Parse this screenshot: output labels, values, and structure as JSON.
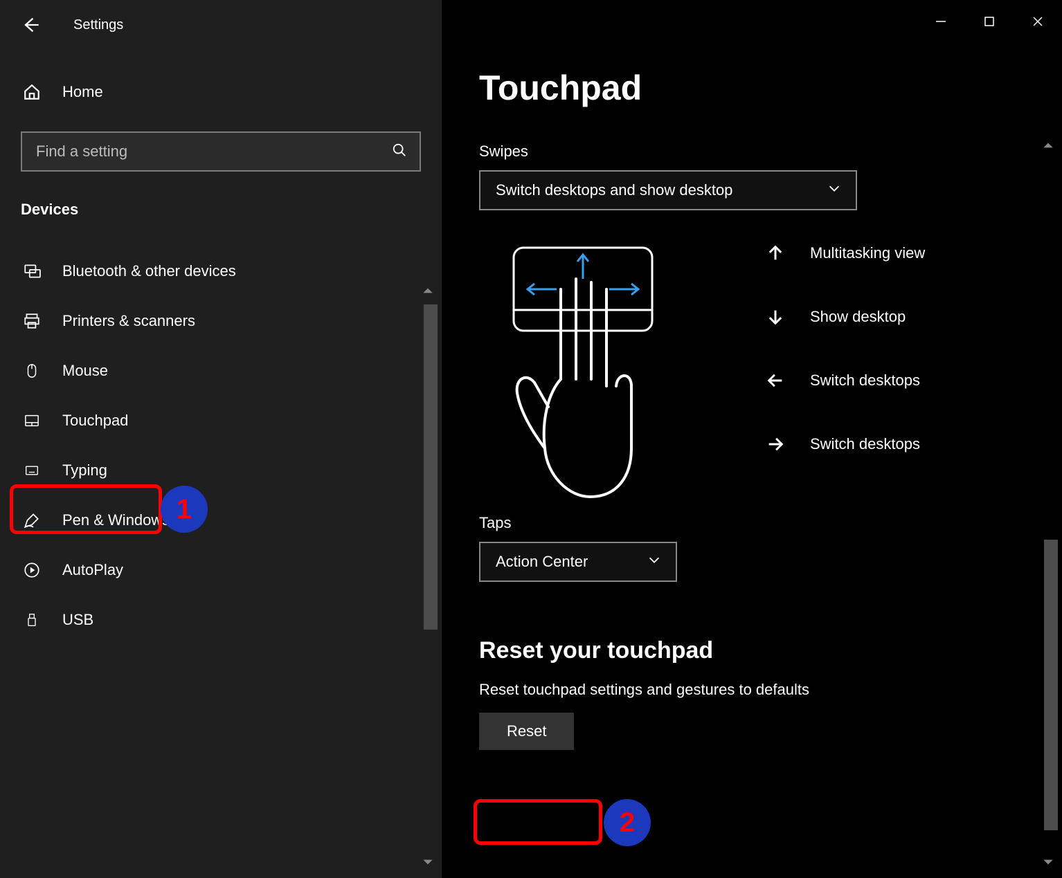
{
  "window": {
    "title": "Settings"
  },
  "sidebar": {
    "home_label": "Home",
    "search_placeholder": "Find a setting",
    "category": "Devices",
    "items": [
      {
        "label": "Bluetooth & other devices"
      },
      {
        "label": "Printers & scanners"
      },
      {
        "label": "Mouse"
      },
      {
        "label": "Touchpad"
      },
      {
        "label": "Typing"
      },
      {
        "label": "Pen & Windows Ink"
      },
      {
        "label": "AutoPlay"
      },
      {
        "label": "USB"
      }
    ]
  },
  "main": {
    "page_title": "Touchpad",
    "swipes": {
      "label": "Swipes",
      "selected": "Switch desktops and show desktop",
      "gestures": [
        {
          "dir": "up",
          "label": "Multitasking view"
        },
        {
          "dir": "down",
          "label": "Show desktop"
        },
        {
          "dir": "left",
          "label": "Switch desktops"
        },
        {
          "dir": "right",
          "label": "Switch desktops"
        }
      ]
    },
    "taps": {
      "label": "Taps",
      "selected": "Action Center"
    },
    "reset": {
      "heading": "Reset your touchpad",
      "sub": "Reset touchpad settings and gestures to defaults",
      "button": "Reset"
    }
  },
  "annotations": {
    "badge1": "1",
    "badge2": "2"
  }
}
